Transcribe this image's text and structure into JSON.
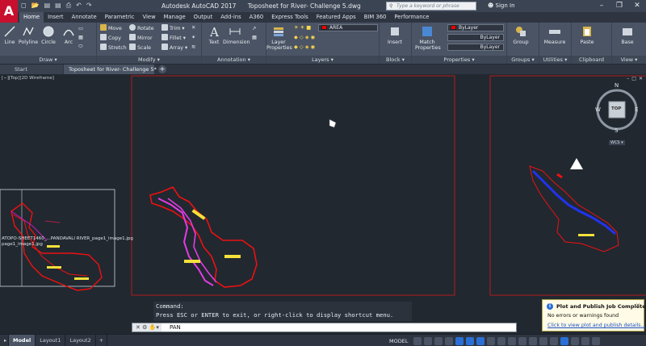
{
  "titlebar": {
    "app_logo": "A",
    "app_name": "Autodesk AutoCAD 2017",
    "document": "Toposheet for River- Challenge 5.dwg",
    "search_placeholder": "Type a keyword or phrase",
    "sign_in": "Sign In"
  },
  "tabs": [
    "Home",
    "Insert",
    "Annotate",
    "Parametric",
    "View",
    "Manage",
    "Output",
    "Add-ins",
    "A360",
    "Express Tools",
    "Featured Apps",
    "BIM 360",
    "Performance"
  ],
  "ribbon": {
    "draw": {
      "title": "Draw",
      "line": "Line",
      "polyline": "Polyline",
      "circle": "Circle",
      "arc": "Arc"
    },
    "modify": {
      "title": "Modify",
      "move": "Move",
      "rotate": "Rotate",
      "trim": "Trim",
      "copy": "Copy",
      "mirror": "Mirror",
      "fillet": "Fillet",
      "stretch": "Stretch",
      "scale": "Scale",
      "array": "Array"
    },
    "annotation": {
      "title": "Annotation",
      "text": "Text",
      "dimension": "Dimension"
    },
    "layers": {
      "title": "Layers",
      "layer_properties": "Layer Properties",
      "current_layer": "AREA"
    },
    "block": {
      "title": "Block",
      "insert": "Insert"
    },
    "properties": {
      "title": "Properties",
      "match_properties": "Match Properties",
      "color": "ByLayer",
      "linetype": "ByLayer",
      "lineweight": "ByLayer"
    },
    "groups": {
      "title": "Groups",
      "group": "Group"
    },
    "utilities": {
      "title": "Utilities",
      "measure": "Measure"
    },
    "clipboard": {
      "title": "Clipboard",
      "paste": "Paste"
    },
    "view": {
      "title": "View",
      "base": "Base"
    }
  },
  "filetabs": {
    "start": "Start",
    "document": "Toposheet for River- Challenge 5*"
  },
  "viewport": {
    "label": "[−][Top][2D Wireframe]"
  },
  "viewcube": {
    "top": "TOP",
    "north": "N",
    "south": "S",
    "east": "E",
    "west": "W",
    "wcs": "WCS ▾"
  },
  "drawing_labels": {
    "line1": "ATOPO-SHEET1460_...PANDAVALI RIVER_page1_image1.jpg",
    "line2": "page1_image1.jpg"
  },
  "command": {
    "history_1": "Command:",
    "history_2": "Press ESC or ENTER to exit, or right-click to display shortcut menu.",
    "current": "PAN"
  },
  "balloon": {
    "title": "Plot and Publish Job Complete",
    "message": "No errors or warnings found",
    "link": "Click to view plot and publish details..."
  },
  "statusbar": {
    "layouts": [
      "Model",
      "Layout1",
      "Layout2"
    ],
    "model_space": "MODEL"
  }
}
